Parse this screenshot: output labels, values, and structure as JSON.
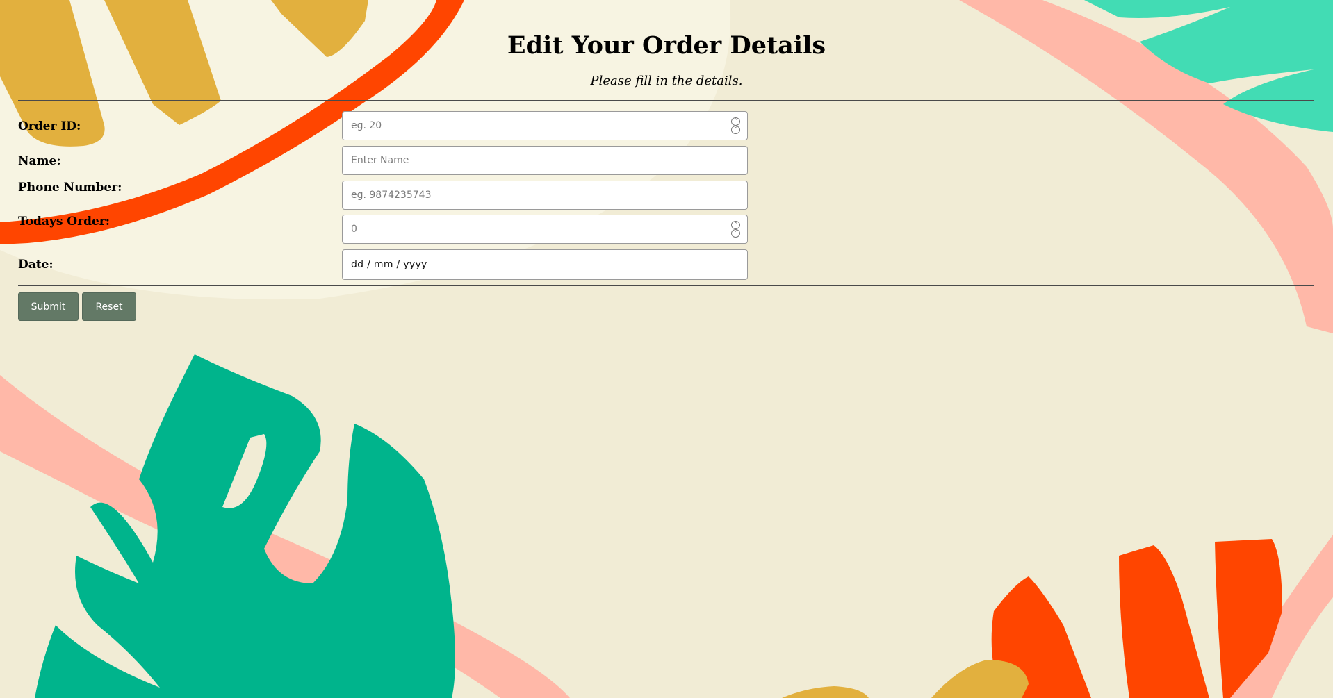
{
  "page": {
    "title": "Edit Your Order Details",
    "subtitle": "Please fill in the details."
  },
  "form": {
    "fields": [
      {
        "label": "Order ID:",
        "placeholder": "eg. 20",
        "type": "number"
      },
      {
        "label": "Name:",
        "placeholder": "Enter Name",
        "type": "text"
      },
      {
        "label": "Phone Number:",
        "placeholder": "eg. 9874235743",
        "type": "tel"
      },
      {
        "label": "Todays Order:",
        "placeholder": "0",
        "type": "number"
      },
      {
        "label": "Date:",
        "value": "dd / mm / yyyy",
        "type": "date"
      }
    ],
    "buttons": {
      "submit": "Submit",
      "reset": "Reset"
    }
  },
  "icons": {
    "spinner_up": "chevron-up-icon",
    "spinner_down": "chevron-down-icon"
  },
  "colors": {
    "background": "#f1ecd5",
    "button": "#637966",
    "accent_orange": "#ff4500",
    "accent_green": "#00b48c",
    "accent_mustard": "#e2b03e",
    "accent_pink": "#ffb8a8",
    "accent_mint": "#42dcb4"
  }
}
